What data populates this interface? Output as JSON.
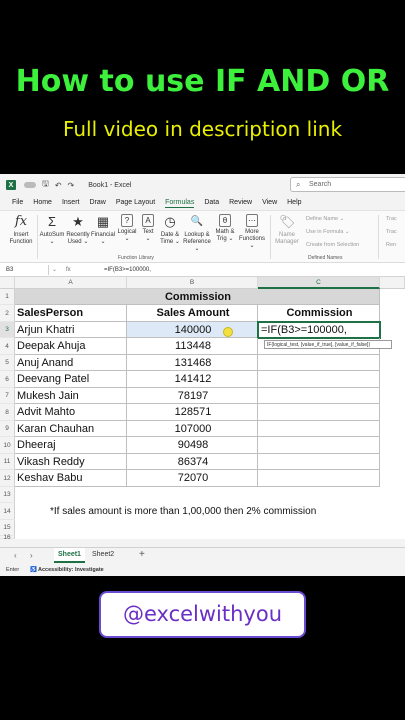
{
  "headline": {
    "title": "How to use IF AND OR",
    "subtitle": "Full video in description link"
  },
  "titlebar": {
    "app_icon_letter": "X",
    "file_name": "Book1  -  Excel",
    "search_placeholder": "Search"
  },
  "menu": [
    "File",
    "Home",
    "Insert",
    "Draw",
    "Page Layout",
    "Formulas",
    "Data",
    "Review",
    "View",
    "Help"
  ],
  "menu_active": "Formulas",
  "ribbon": {
    "buttons": [
      {
        "icon": "fx",
        "line1": "Insert",
        "line2": "Function"
      },
      {
        "icon": "Σ",
        "line1": "AutoSum",
        "line2": "⌄"
      },
      {
        "icon": "★",
        "line1": "Recently",
        "line2": "Used ⌄"
      },
      {
        "icon": "▦",
        "line1": "Financial",
        "line2": "⌄"
      },
      {
        "icon": "?",
        "line1": "Logical",
        "line2": "⌄"
      },
      {
        "icon": "A",
        "line1": "Text",
        "line2": "⌄"
      },
      {
        "icon": "◷",
        "line1": "Date &",
        "line2": "Time ⌄"
      },
      {
        "icon": "🔍",
        "line1": "Lookup &",
        "line2": "Reference ⌄"
      },
      {
        "icon": "θ",
        "line1": "Math &",
        "line2": "Trig ⌄"
      },
      {
        "icon": "⋯",
        "line1": "More",
        "line2": "Functions ⌄"
      }
    ],
    "function_library_label": "Function Library",
    "name_manager": {
      "line1": "Name",
      "line2": "Manager"
    },
    "defined_names_items": [
      "Define Name ⌄",
      "Use in Formula ⌄",
      "Create from Selection"
    ],
    "defined_names_label": "Defined Names",
    "trace_items": [
      "Trac",
      "Trac",
      "Ren"
    ]
  },
  "formula_bar": {
    "name_box": "B3",
    "fx_label": "fx",
    "formula": "=IF(B3>=100000,"
  },
  "columns": [
    "A",
    "B",
    "C"
  ],
  "rows": [
    "1",
    "2",
    "3",
    "4",
    "5",
    "6",
    "7",
    "8",
    "9",
    "10",
    "11",
    "12",
    "13",
    "14",
    "15",
    "16"
  ],
  "sheet": {
    "title": "Commission",
    "headers": [
      "SalesPerson",
      "Sales Amount",
      "Commission"
    ],
    "people": [
      {
        "name": "Arjun Khatri",
        "amount": "140000"
      },
      {
        "name": "Deepak Ahuja",
        "amount": "113448"
      },
      {
        "name": "Anuj Anand",
        "amount": "131468"
      },
      {
        "name": "Deevang Patel",
        "amount": "141412"
      },
      {
        "name": "Mukesh Jain",
        "amount": "78197"
      },
      {
        "name": "Advit Mahto",
        "amount": "128571"
      },
      {
        "name": "Karan Chauhan",
        "amount": "107000"
      },
      {
        "name": "Dheeraj",
        "amount": "90498"
      },
      {
        "name": "Vikash Reddy",
        "amount": "86374"
      },
      {
        "name": "Keshav Babu",
        "amount": "72070"
      }
    ],
    "editing_cell": "=IF(B3>=100000,",
    "tooltip": "IF(logical_test, [value_if_true], [value_if_false])",
    "note": "*If sales amount is more than 1,00,000 then 2% commission"
  },
  "tabs": [
    "Sheet1",
    "Sheet2"
  ],
  "tab_add": "+",
  "status": {
    "mode": "Enter",
    "accessibility": "Accessibility: Investigate"
  },
  "badge": "@excelwithyou",
  "colors": {
    "excel_green": "#1e7145",
    "headline_green": "#3cf03c",
    "headline_yellow": "#e8f000",
    "badge_purple": "#6a2fc4"
  }
}
